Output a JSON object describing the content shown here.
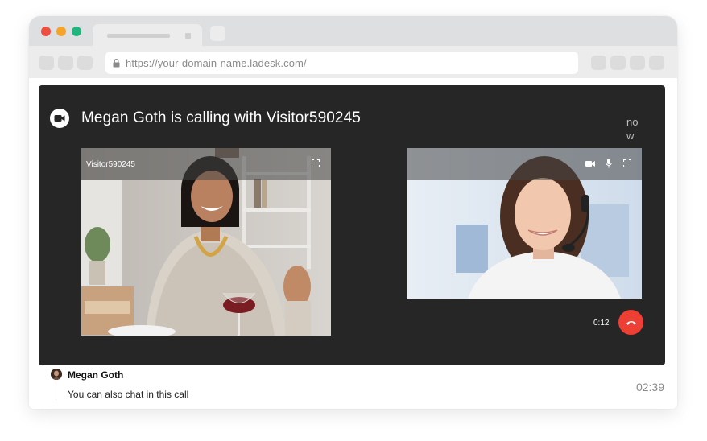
{
  "browser": {
    "url": "https://your-domain-name.ladesk.com/",
    "colors": {
      "close": "#ee4d42",
      "minimize": "#f4a42b",
      "maximize": "#21b47e"
    }
  },
  "call": {
    "title": "Megan Goth is calling with Visitor590245",
    "time_label": "now",
    "call_icon": "video-camera-icon",
    "visitor_video": {
      "name": "Visitor590245",
      "controls": [
        "fullscreen-icon"
      ]
    },
    "agent_video": {
      "controls": [
        "camera-icon",
        "microphone-icon",
        "fullscreen-icon"
      ]
    },
    "duration": "0:12",
    "hangup_icon": "phone-hangup-icon",
    "colors": {
      "panel": "#262626",
      "hangup": "#ee3f34"
    }
  },
  "chat": {
    "author": "Megan Goth",
    "message": "You can also chat in this call",
    "time": "02:39"
  }
}
